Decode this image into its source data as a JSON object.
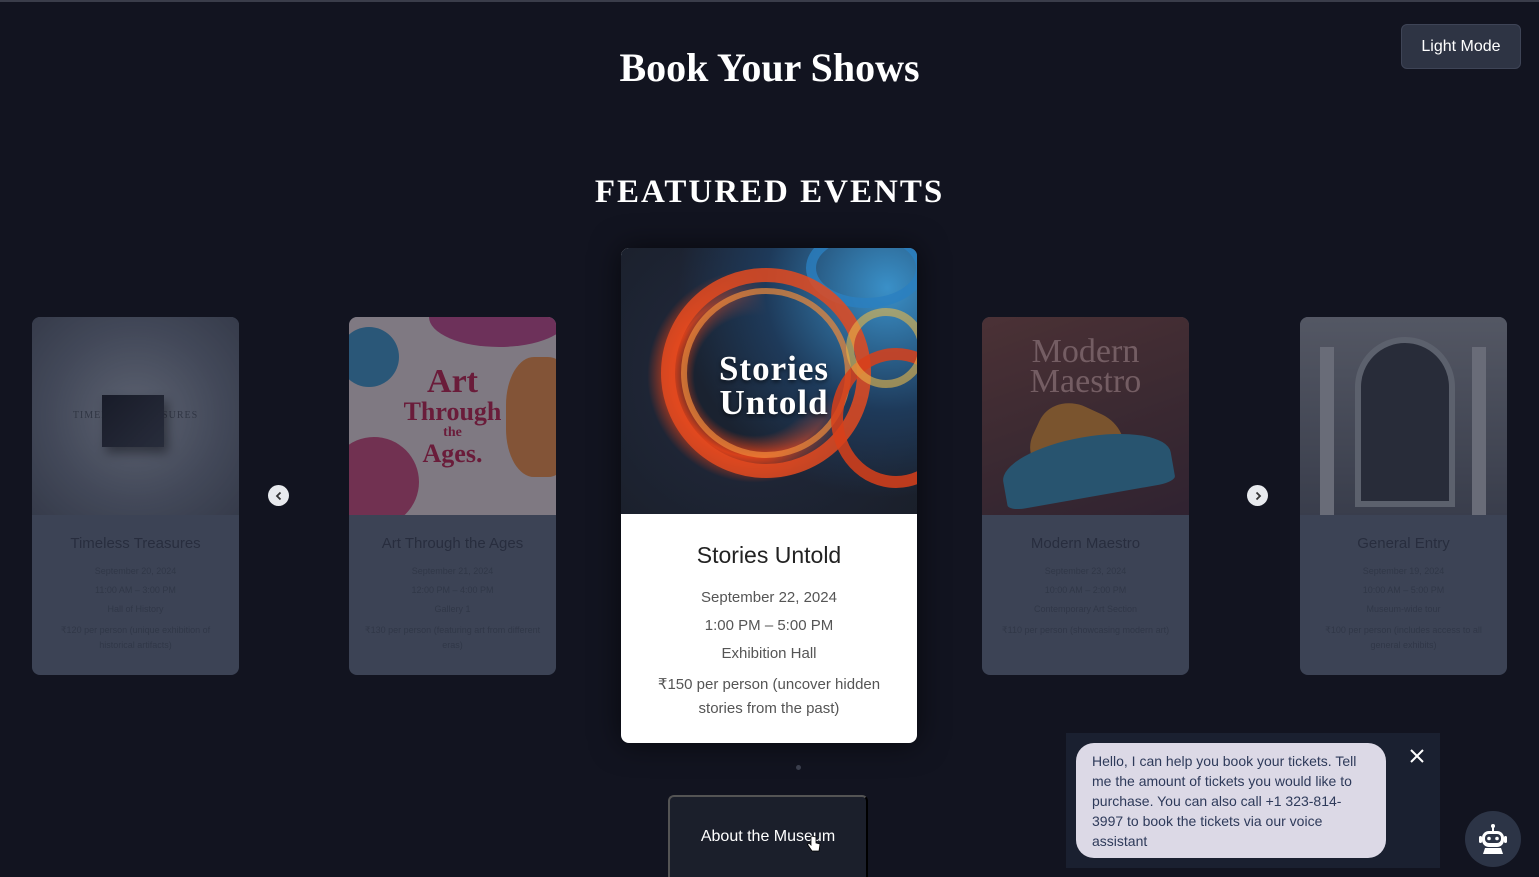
{
  "header": {
    "title": "Book Your Shows",
    "theme_toggle_label": "Light Mode"
  },
  "featured": {
    "heading": "FEATURED EVENTS",
    "cards": [
      {
        "title": "Timeless Treasures",
        "thumb_text": "TIMELESS TREASURES",
        "date": "September 20, 2024",
        "time": "11:00 AM – 3:00 PM",
        "location": "Hall of History",
        "description": "₹120 per person (unique exhibition of historical artifacts)"
      },
      {
        "title": "Art Through the Ages",
        "thumb_line1": "Art",
        "thumb_line2": "Through",
        "thumb_line3": "the",
        "thumb_line4": "Ages.",
        "date": "September 21, 2024",
        "time": "12:00 PM – 4:00 PM",
        "location": "Gallery 1",
        "description": "₹130 per person (featuring art from different eras)"
      },
      {
        "title": "Stories Untold",
        "thumb_line1": "Stories",
        "thumb_line2": "Untold",
        "date": "September 22, 2024",
        "time": "1:00 PM – 5:00 PM",
        "location": "Exhibition Hall",
        "description": "₹150 per person (uncover hidden stories from the past)"
      },
      {
        "title": "Modern Maestro",
        "thumb_line1": "Modern",
        "thumb_line2": "Maestro",
        "date": "September 23, 2024",
        "time": "10:00 AM – 2:00 PM",
        "location": "Contemporary Art Section",
        "description": "₹110 per person (showcasing modern art)"
      },
      {
        "title": "General Entry",
        "date": "September 19, 2024",
        "time": "10:00 AM – 5:00 PM",
        "location": "Museum-wide tour",
        "description": "₹100 per person (includes access to all general exhibits)"
      }
    ],
    "prev_icon": "chevron-left-icon",
    "next_icon": "chevron-right-icon"
  },
  "about_button_label": "About the Museum",
  "chat": {
    "message": "Hello, I can help you book your tickets. Tell me the amount of tickets you would like to purchase. You can also call +1 323-814-3997 to book the tickets via our voice assistant",
    "close_icon": "close-icon",
    "bot_icon": "robot-icon"
  },
  "colors": {
    "background": "#121420",
    "card_white": "#ffffff",
    "toggle_bg": "#2e3444",
    "chat_bubble": "#dcd9e6"
  }
}
